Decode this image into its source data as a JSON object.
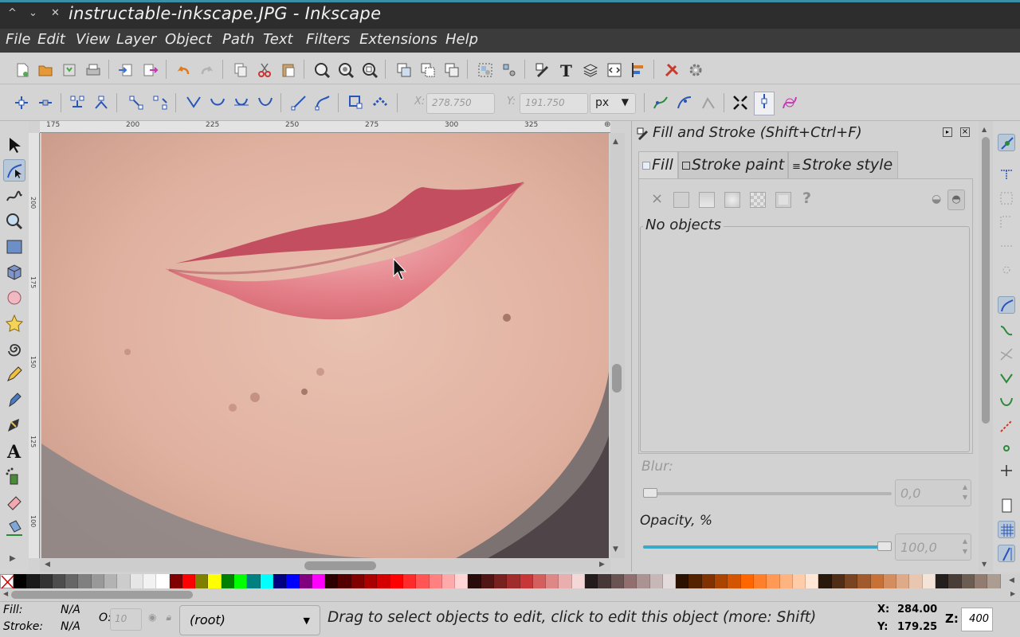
{
  "window": {
    "title": "instructable-inkscape.JPG - Inkscape",
    "controls": [
      "^",
      "⌄",
      "✕"
    ]
  },
  "menubar": {
    "items": [
      "File",
      "Edit",
      "View",
      "Layer",
      "Object",
      "Path",
      "Text",
      "Filters",
      "Extensions",
      "Help"
    ]
  },
  "node_toolbar": {
    "x_label": "X:",
    "x_value": "278.750",
    "y_label": "Y:",
    "y_value": "191.750",
    "unit": "px"
  },
  "rulers": {
    "top_ticks": [
      "175",
      "200",
      "225",
      "250",
      "275",
      "300",
      "325"
    ],
    "left_ticks": [
      "200",
      "175",
      "150",
      "125",
      "100"
    ]
  },
  "fill_stroke_panel": {
    "title": "Fill and Stroke (Shift+Ctrl+F)",
    "tabs": [
      "Fill",
      "Stroke paint",
      "Stroke style"
    ],
    "paint_none_glyph": "×",
    "paint_unset_glyph": "?",
    "no_objects_text": "No objects",
    "blur_label": "Blur:",
    "blur_value": "0,0",
    "opacity_label": "Opacity, %",
    "opacity_value": "100,0",
    "opacity_fraction": 1.0,
    "blur_fraction": 0.0
  },
  "statusbar": {
    "fill_label": "Fill:",
    "fill_value": "N/A",
    "stroke_label": "Stroke:",
    "stroke_value": "N/A",
    "opacity_label": "O:",
    "opacity_value": "10",
    "layer": "(root)",
    "message": "Drag to select objects to edit, click to edit this object (more: Shift)",
    "x_label": "X:",
    "x_value": "284.00",
    "y_label": "Y:",
    "y_value": "179.25",
    "zoom_label": "Z:",
    "zoom_value": "400"
  },
  "palette": {
    "colors": [
      "#000000",
      "#1a1a1a",
      "#333333",
      "#4d4d4d",
      "#666666",
      "#808080",
      "#999999",
      "#b3b3b3",
      "#cccccc",
      "#e6e6e6",
      "#f2f2f2",
      "#ffffff",
      "#800000",
      "#ff0000",
      "#808000",
      "#ffff00",
      "#008000",
      "#00ff00",
      "#008080",
      "#00ffff",
      "#000080",
      "#0000ff",
      "#800080",
      "#ff00ff",
      "#2b0000",
      "#550000",
      "#800000",
      "#aa0000",
      "#d40000",
      "#ff0000",
      "#ff2a2a",
      "#ff5555",
      "#ff8080",
      "#ffaaaa",
      "#ffd5d5",
      "#280b0b",
      "#501616",
      "#782121",
      "#a02c2c",
      "#c83737",
      "#d35f5f",
      "#de8787",
      "#e9afaf",
      "#f4d7d7",
      "#241c1c",
      "#483737",
      "#6c5353",
      "#916f6f",
      "#ac9393",
      "#c8b7b7",
      "#e3dbdb",
      "#2b1100",
      "#552200",
      "#803300",
      "#aa4400",
      "#d45500",
      "#ff6600",
      "#ff7f2a",
      "#ff9955",
      "#ffb380",
      "#ffccaa",
      "#ffe6d5",
      "#28170b",
      "#502d16",
      "#784421",
      "#a05a2c",
      "#c87137",
      "#d38d5f",
      "#deaa87",
      "#e9c6af",
      "#f4e3d7",
      "#241f1c",
      "#483e37",
      "#6c5d53",
      "#917c6f",
      "#ac9d93"
    ]
  },
  "colors": {
    "lip_fill": "#c34e5f",
    "skin": "#e3b6a5",
    "accent": "#3a8ea5"
  }
}
